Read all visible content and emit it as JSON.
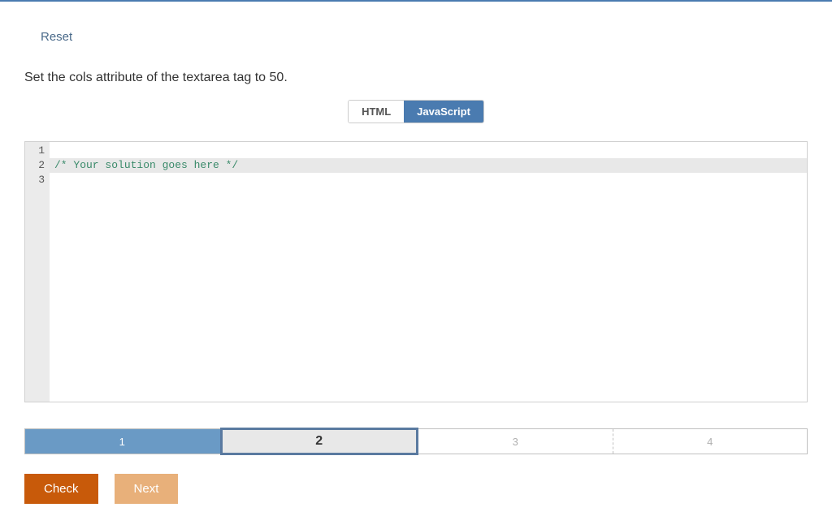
{
  "reset": {
    "label": "Reset"
  },
  "instruction": {
    "text": "Set the cols attribute of the textarea tag to 50."
  },
  "tabs": [
    {
      "label": "HTML",
      "active": false
    },
    {
      "label": "JavaScript",
      "active": true
    }
  ],
  "editor": {
    "lines": [
      {
        "num": "1",
        "content": "",
        "highlighted": false
      },
      {
        "num": "2",
        "content": "/* Your solution goes here */",
        "highlighted": true,
        "type": "comment"
      },
      {
        "num": "3",
        "content": "",
        "highlighted": false
      }
    ]
  },
  "steps": [
    {
      "label": "1",
      "state": "completed"
    },
    {
      "label": "2",
      "state": "active"
    },
    {
      "label": "3",
      "state": "pending"
    },
    {
      "label": "4",
      "state": "pending"
    }
  ],
  "buttons": {
    "check": "Check",
    "next": "Next"
  }
}
